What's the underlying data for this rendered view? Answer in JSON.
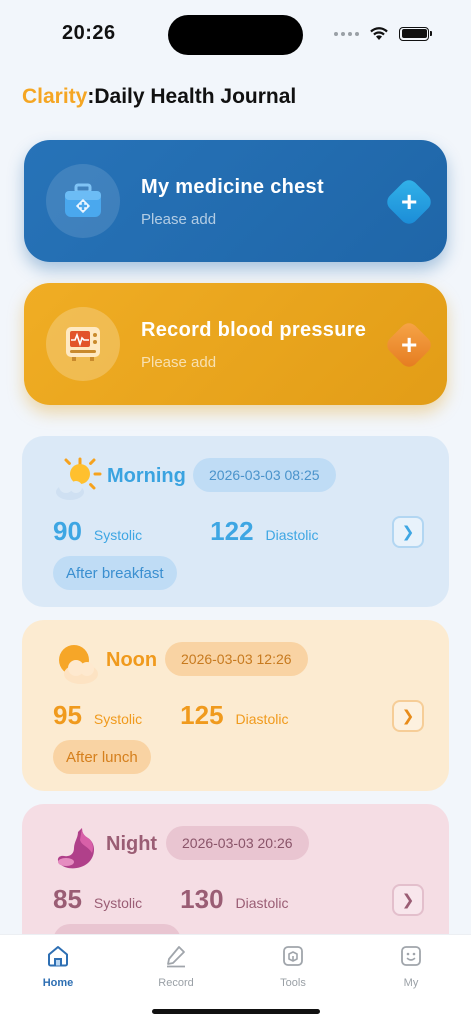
{
  "status_bar": {
    "time": "20:26"
  },
  "header": {
    "brand": "Clarity",
    "subtitle": ":Daily Health Journal"
  },
  "actions": {
    "medicine": {
      "title": "My medicine chest",
      "subtitle": "Please add",
      "add_symbol": "+"
    },
    "blood_pressure": {
      "title": "Record blood pressure",
      "subtitle": "Please add",
      "add_symbol": "+"
    }
  },
  "readings": [
    {
      "period": "Morning",
      "datetime": "2026-03-03 08:25",
      "systolic": "90",
      "systolic_label": "Systolic",
      "diastolic": "122",
      "diastolic_label": "Diastolic",
      "tag": "After breakfast",
      "icon": "sun-cloud-icon"
    },
    {
      "period": "Noon",
      "datetime": "2026-03-03 12:26",
      "systolic": "95",
      "systolic_label": "Systolic",
      "diastolic": "125",
      "diastolic_label": "Diastolic",
      "tag": "After lunch",
      "icon": "sun-behind-cloud-icon"
    },
    {
      "period": "Night",
      "datetime": "2026-03-03 20:26",
      "systolic": "85",
      "systolic_label": "Systolic",
      "diastolic": "130",
      "diastolic_label": "Diastolic",
      "tag": "",
      "icon": "stomach-icon"
    }
  ],
  "tabs": [
    {
      "label": "Home",
      "icon": "home-icon",
      "active": true
    },
    {
      "label": "Record",
      "icon": "pen-icon",
      "active": false
    },
    {
      "label": "Tools",
      "icon": "box-icon",
      "active": false
    },
    {
      "label": "My",
      "icon": "smiley-icon",
      "active": false
    }
  ],
  "colors": {
    "brand": "#f5a623",
    "medicine_card": "#2773b8",
    "bp_card": "#f0ad24",
    "active_tab": "#2e6fb3"
  }
}
